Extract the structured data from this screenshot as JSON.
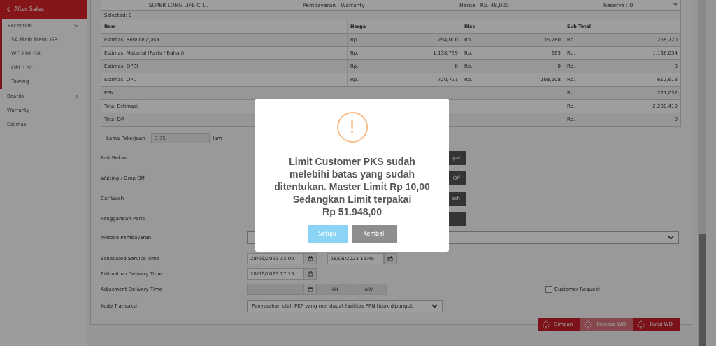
{
  "sidebar": {
    "header": "After Sales",
    "items": [
      {
        "label": "Reception",
        "expanded": true,
        "children": [
          {
            "label": "SA Main Menu GR"
          },
          {
            "label": "WO List GR"
          },
          {
            "label": "OPL List"
          },
          {
            "label": "Towing"
          }
        ]
      },
      {
        "label": "Boards",
        "expanded": false
      },
      {
        "label": "Warranty"
      },
      {
        "label": "Estimasi"
      }
    ]
  },
  "part_strip": [
    "SUPER LONG LIFE C 1L",
    "Pembayaran : Warranty",
    "Harga : Rp. 48,000",
    "Reserve : 0"
  ],
  "selected_count": "Selected: 0",
  "table": {
    "columns": [
      "Item",
      "Harga",
      "Disc",
      "Sub Total"
    ],
    "rows": [
      {
        "kind": "full",
        "cells": [
          "Estimasi Service / Jasa",
          {
            "currency": "Rp.",
            "amount": "294,000"
          },
          {
            "currency": "Rp.",
            "amount": "35,280"
          },
          {
            "currency": "Rp.",
            "amount": "258,720"
          }
        ]
      },
      {
        "kind": "full",
        "cells": [
          "Estimasi Material (Parts / Bahan)",
          {
            "currency": "Rp.",
            "amount": "1,138,739"
          },
          {
            "currency": "Rp.",
            "amount": "685"
          },
          {
            "currency": "Rp.",
            "amount": "1,138,054"
          }
        ]
      },
      {
        "kind": "full",
        "cells": [
          "Estimasi OPBI",
          {
            "currency": "Rp.",
            "amount": "0"
          },
          {
            "currency": "Rp.",
            "amount": "0"
          },
          {
            "currency": "Rp.",
            "amount": "0"
          }
        ]
      },
      {
        "kind": "full",
        "cells": [
          "Estimasi OPL",
          {
            "currency": "Rp.",
            "amount": "720,721"
          },
          {
            "currency": "Rp.",
            "amount": "108,108"
          },
          {
            "currency": "Rp.",
            "amount": "612,613"
          }
        ]
      },
      {
        "kind": "total",
        "cells": [
          "PPN",
          "",
          "",
          {
            "currency": "Rp.",
            "amount": "221,032"
          }
        ]
      },
      {
        "kind": "total",
        "cells": [
          "Total Estimasi",
          "",
          "",
          {
            "currency": "Rp.",
            "amount": "2,230,419"
          }
        ]
      },
      {
        "kind": "total",
        "cells": [
          "Total DP",
          "",
          "",
          {
            "currency": "Rp.",
            "amount": "0"
          }
        ]
      }
    ]
  },
  "lama_pekerjaan": {
    "label": "Lama Pekerjaan :",
    "value": "3.75",
    "unit": "Jam"
  },
  "form": [
    {
      "kind": "toggle",
      "label": "Part Bekas",
      "button": "gal"
    },
    {
      "kind": "toggle",
      "label": "Waiting / Drop Off",
      "button": "Off"
    },
    {
      "kind": "toggle",
      "label": "Car Wash",
      "button": "ash"
    },
    {
      "kind": "toggle",
      "label": "Penggantian Parts"
    },
    {
      "kind": "select",
      "label": "Metode Pembayaran",
      "wide": true
    },
    {
      "kind": "range",
      "label": "Scheduled Service Time",
      "start": "28/06/2023 13:00",
      "separator": "-",
      "end": "28/06/2023 16:45"
    },
    {
      "kind": "date",
      "label": "Estimation Delivery Time",
      "value": "28/06/2023 17:15"
    },
    {
      "kind": "adjust",
      "label": "Adjusment Delivery Time",
      "hour": "HH",
      "minute": "MM",
      "checkbox": {
        "label": "Customer Request",
        "checked": false
      }
    },
    {
      "kind": "select",
      "label": "Kode Transaksi",
      "value": "Penyerahan oleh PKP yang mendapat fasilitas PPN tidak dipungut",
      "wide": false
    }
  ],
  "actions": [
    {
      "label": "Simpan",
      "disabled": false
    },
    {
      "label": "Release WO",
      "disabled": true
    },
    {
      "label": "Batal WO",
      "disabled": false
    }
  ],
  "dialog": {
    "icon": "!",
    "message_lines": [
      "Limit Customer PKS sudah",
      "melebihi batas yang sudah",
      "ditentukan. Master Limit Rp 10,00",
      "Sedangkan Limit terpakai",
      "Rp 51.948,00"
    ],
    "buttons": [
      {
        "label": "Setuju",
        "kind": "confirm"
      },
      {
        "label": "Kembali",
        "kind": "cancel"
      }
    ]
  }
}
